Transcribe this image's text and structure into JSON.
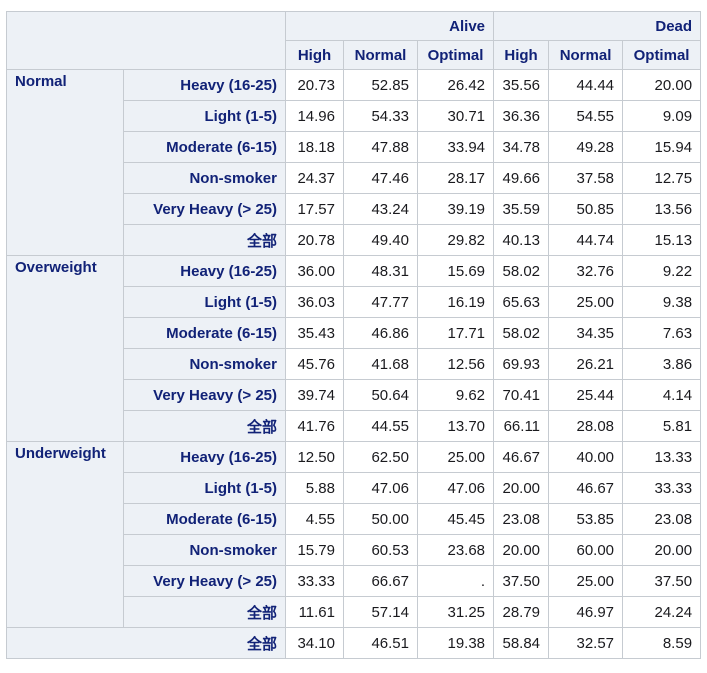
{
  "colors": {
    "header_background": "#EDF1F6",
    "header_text": "#112277",
    "cell_border": "#C6CBD1",
    "data_text": "#1A1A1E",
    "page_background": "#FFFFFF"
  },
  "chart_data": {
    "type": "table",
    "title": "",
    "column_groups": [
      {
        "label": "Alive",
        "span": 3
      },
      {
        "label": "Dead",
        "span": 3
      }
    ],
    "columns": [
      "High",
      "Normal",
      "Optimal",
      "High",
      "Normal",
      "Optimal"
    ],
    "row_groups": [
      {
        "label": "Normal",
        "rows": [
          {
            "label": "Heavy (16-25)",
            "values": [
              "20.73",
              "52.85",
              "26.42",
              "35.56",
              "44.44",
              "20.00"
            ]
          },
          {
            "label": "Light (1-5)",
            "values": [
              "14.96",
              "54.33",
              "30.71",
              "36.36",
              "54.55",
              "9.09"
            ]
          },
          {
            "label": "Moderate (6-15)",
            "values": [
              "18.18",
              "47.88",
              "33.94",
              "34.78",
              "49.28",
              "15.94"
            ]
          },
          {
            "label": "Non-smoker",
            "values": [
              "24.37",
              "47.46",
              "28.17",
              "49.66",
              "37.58",
              "12.75"
            ]
          },
          {
            "label": "Very Heavy (> 25)",
            "values": [
              "17.57",
              "43.24",
              "39.19",
              "35.59",
              "50.85",
              "13.56"
            ]
          },
          {
            "label": "全部",
            "values": [
              "20.78",
              "49.40",
              "29.82",
              "40.13",
              "44.74",
              "15.13"
            ]
          }
        ]
      },
      {
        "label": "Overweight",
        "rows": [
          {
            "label": "Heavy (16-25)",
            "values": [
              "36.00",
              "48.31",
              "15.69",
              "58.02",
              "32.76",
              "9.22"
            ]
          },
          {
            "label": "Light (1-5)",
            "values": [
              "36.03",
              "47.77",
              "16.19",
              "65.63",
              "25.00",
              "9.38"
            ]
          },
          {
            "label": "Moderate (6-15)",
            "values": [
              "35.43",
              "46.86",
              "17.71",
              "58.02",
              "34.35",
              "7.63"
            ]
          },
          {
            "label": "Non-smoker",
            "values": [
              "45.76",
              "41.68",
              "12.56",
              "69.93",
              "26.21",
              "3.86"
            ]
          },
          {
            "label": "Very Heavy (> 25)",
            "values": [
              "39.74",
              "50.64",
              "9.62",
              "70.41",
              "25.44",
              "4.14"
            ]
          },
          {
            "label": "全部",
            "values": [
              "41.76",
              "44.55",
              "13.70",
              "66.11",
              "28.08",
              "5.81"
            ]
          }
        ]
      },
      {
        "label": "Underweight",
        "rows": [
          {
            "label": "Heavy (16-25)",
            "values": [
              "12.50",
              "62.50",
              "25.00",
              "46.67",
              "40.00",
              "13.33"
            ]
          },
          {
            "label": "Light (1-5)",
            "values": [
              "5.88",
              "47.06",
              "47.06",
              "20.00",
              "46.67",
              "33.33"
            ]
          },
          {
            "label": "Moderate (6-15)",
            "values": [
              "4.55",
              "50.00",
              "45.45",
              "23.08",
              "53.85",
              "23.08"
            ]
          },
          {
            "label": "Non-smoker",
            "values": [
              "15.79",
              "60.53",
              "23.68",
              "20.00",
              "60.00",
              "20.00"
            ]
          },
          {
            "label": "Very Heavy (> 25)",
            "values": [
              "33.33",
              "66.67",
              ".",
              "37.50",
              "25.00",
              "37.50"
            ]
          },
          {
            "label": "全部",
            "values": [
              "11.61",
              "57.14",
              "31.25",
              "28.79",
              "46.97",
              "24.24"
            ]
          }
        ]
      }
    ],
    "total_row": {
      "label": "全部",
      "values": [
        "34.10",
        "46.51",
        "19.38",
        "58.84",
        "32.57",
        "8.59"
      ]
    }
  }
}
